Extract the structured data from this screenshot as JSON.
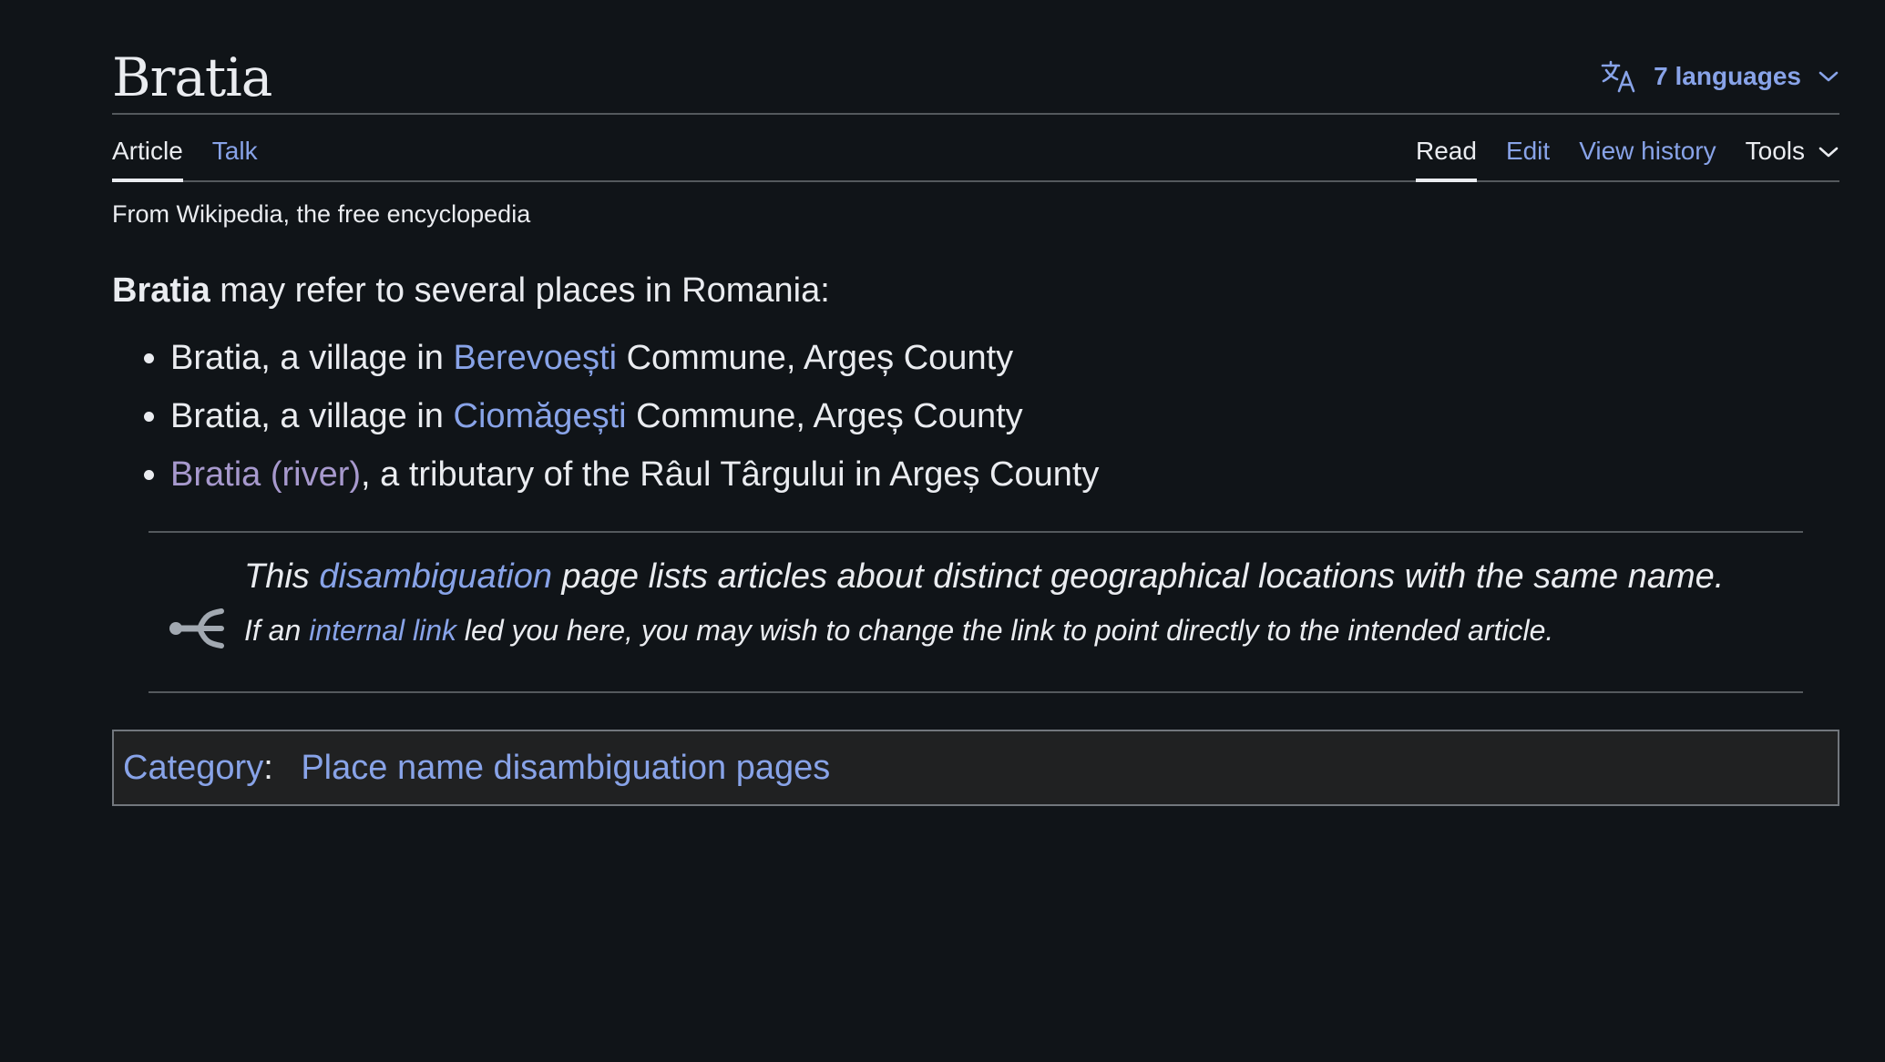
{
  "header": {
    "title": "Bratia",
    "languages_label": "7 languages"
  },
  "tabs": {
    "article": "Article",
    "talk": "Talk",
    "read": "Read",
    "edit": "Edit",
    "view_history": "View history",
    "tools": "Tools"
  },
  "tagline": "From Wikipedia, the free encyclopedia",
  "intro": {
    "bold": "Bratia",
    "rest": " may refer to several places in Romania:"
  },
  "entries": [
    {
      "prefix": "Bratia, a village in ",
      "link": "Berevoești",
      "suffix": " Commune, Argeș County"
    },
    {
      "prefix": "Bratia, a village in ",
      "link": "Ciomăgești",
      "suffix": " Commune, Argeș County"
    },
    {
      "link": "Bratia (river)",
      "suffix": ", a tributary of the Râul Târgului in Argeș County"
    }
  ],
  "disambiguation": {
    "main_prefix": "This ",
    "main_link": "disambiguation",
    "main_suffix": " page lists articles about distinct geographical locations with the same name.",
    "sub_prefix": "If an ",
    "sub_link": "internal link",
    "sub_suffix": " led you here, you may wish to change the link to point directly to the intended article."
  },
  "categories": {
    "label": "Category",
    "separator": ":",
    "items": [
      "Place name disambiguation pages"
    ]
  },
  "colors": {
    "background": "#101418",
    "text": "#eaecf0",
    "link": "#88a3e8",
    "visited_link": "#a799cd",
    "border": "#54595d"
  },
  "icons": [
    "translate-icon",
    "chevron-down-icon",
    "disambiguation-icon"
  ]
}
